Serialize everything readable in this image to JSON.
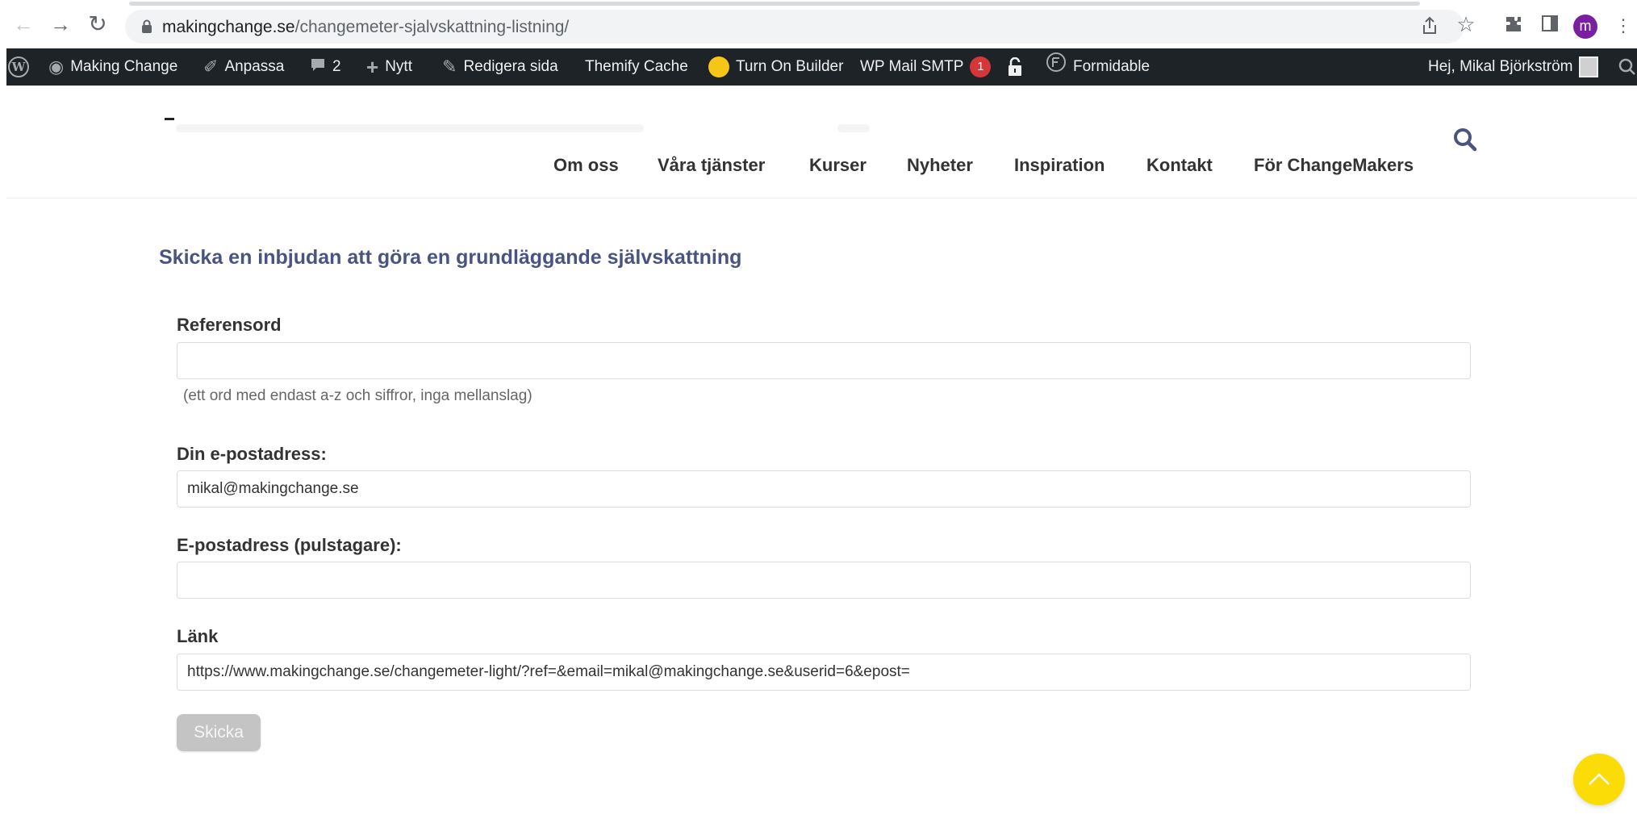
{
  "browser": {
    "url_domain": "makingchange.se",
    "url_path": "/changemeter-sjalvskattning-listning/",
    "profile_initial": "m"
  },
  "adminbar": {
    "site_name": "Making Change",
    "customize": "Anpassa",
    "comments_count": "2",
    "new": "Nytt",
    "edit_page": "Redigera sida",
    "themify_cache": "Themify Cache",
    "turn_on_builder": "Turn On Builder",
    "wp_mail_smtp": "WP Mail SMTP",
    "wp_mail_smtp_badge": "1",
    "formidable": "Formidable",
    "greeting": "Hej, Mikal Björkström"
  },
  "nav": {
    "items": [
      "Om oss",
      "Våra tjänster",
      "Kurser",
      "Nyheter",
      "Inspiration",
      "Kontakt",
      "För ChangeMakers"
    ]
  },
  "form": {
    "heading": "Skicka en inbjudan att göra en grundläggande självskattning",
    "ref_label": "Referensord",
    "ref_value": "",
    "ref_help": "(ett ord med endast a-z och siffror, inga mellanslag)",
    "email_label": "Din e-postadress:",
    "email_value": "mikal@makingchange.se",
    "recipient_label": "E-postadress (pulstagare):",
    "recipient_value": "",
    "link_label": "Länk",
    "link_value": "https://www.makingchange.se/changemeter-light/?ref=&email=mikal@makingchange.se&userid=6&epost=",
    "submit_label": "Skicka"
  },
  "colors": {
    "adminbar_bg": "#1d2327",
    "heading": "#4a5480",
    "scroll_top": "#fbdc07",
    "badge": "#d63638"
  }
}
